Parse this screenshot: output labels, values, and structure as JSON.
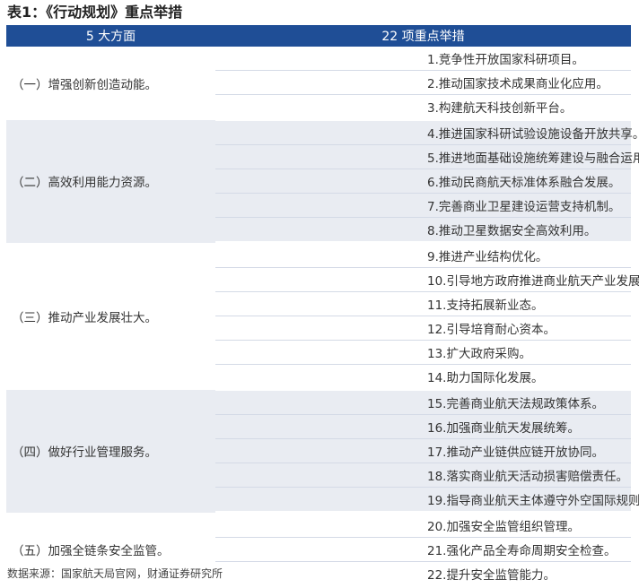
{
  "title": "表1：《行动规划》重点举措",
  "table": {
    "headers": [
      "5 大方面",
      "22 项重点举措"
    ],
    "groups": [
      {
        "aspect": "（一）增强创新创造动能。",
        "measures": [
          "1.竞争性开放国家科研项目。",
          "2.推动国家技术成果商业化应用。",
          "3.构建航天科技创新平台。"
        ]
      },
      {
        "aspect": "（二）高效利用能力资源。",
        "measures": [
          "4.推进国家科研试验设施设备开放共享。",
          "5.推进地面基础设施统筹建设与融合运用。",
          "6.推动民商航天标准体系融合发展。",
          "7.完善商业卫星建设运营支持机制。",
          "8.推动卫星数据安全高效利用。"
        ]
      },
      {
        "aspect": "（三）推动产业发展壮大。",
        "measures": [
          "9.推进产业结构优化。",
          "10.引导地方政府推进商业航天产业发展。",
          "11.支持拓展新业态。",
          "12.引导培育耐心资本。",
          "13.扩大政府采购。",
          "14.助力国际化发展。"
        ]
      },
      {
        "aspect": "（四）做好行业管理服务。",
        "measures": [
          "15.完善商业航天法规政策体系。",
          "16.加强商业航天发展统筹。",
          "17.推动产业链供应链开放协同。",
          "18.落实商业航天活动损害赔偿责任。",
          "19.指导商业航天主体遵守外空国际规则。"
        ]
      },
      {
        "aspect": "（五）加强全链条安全监管。",
        "measures": [
          "20.加强安全监管组织管理。",
          "21.强化产品全寿命周期安全检查。",
          "22.提升安全监管能力。"
        ]
      }
    ]
  },
  "source": "数据来源：国家航天局官网，财通证券研究所"
}
